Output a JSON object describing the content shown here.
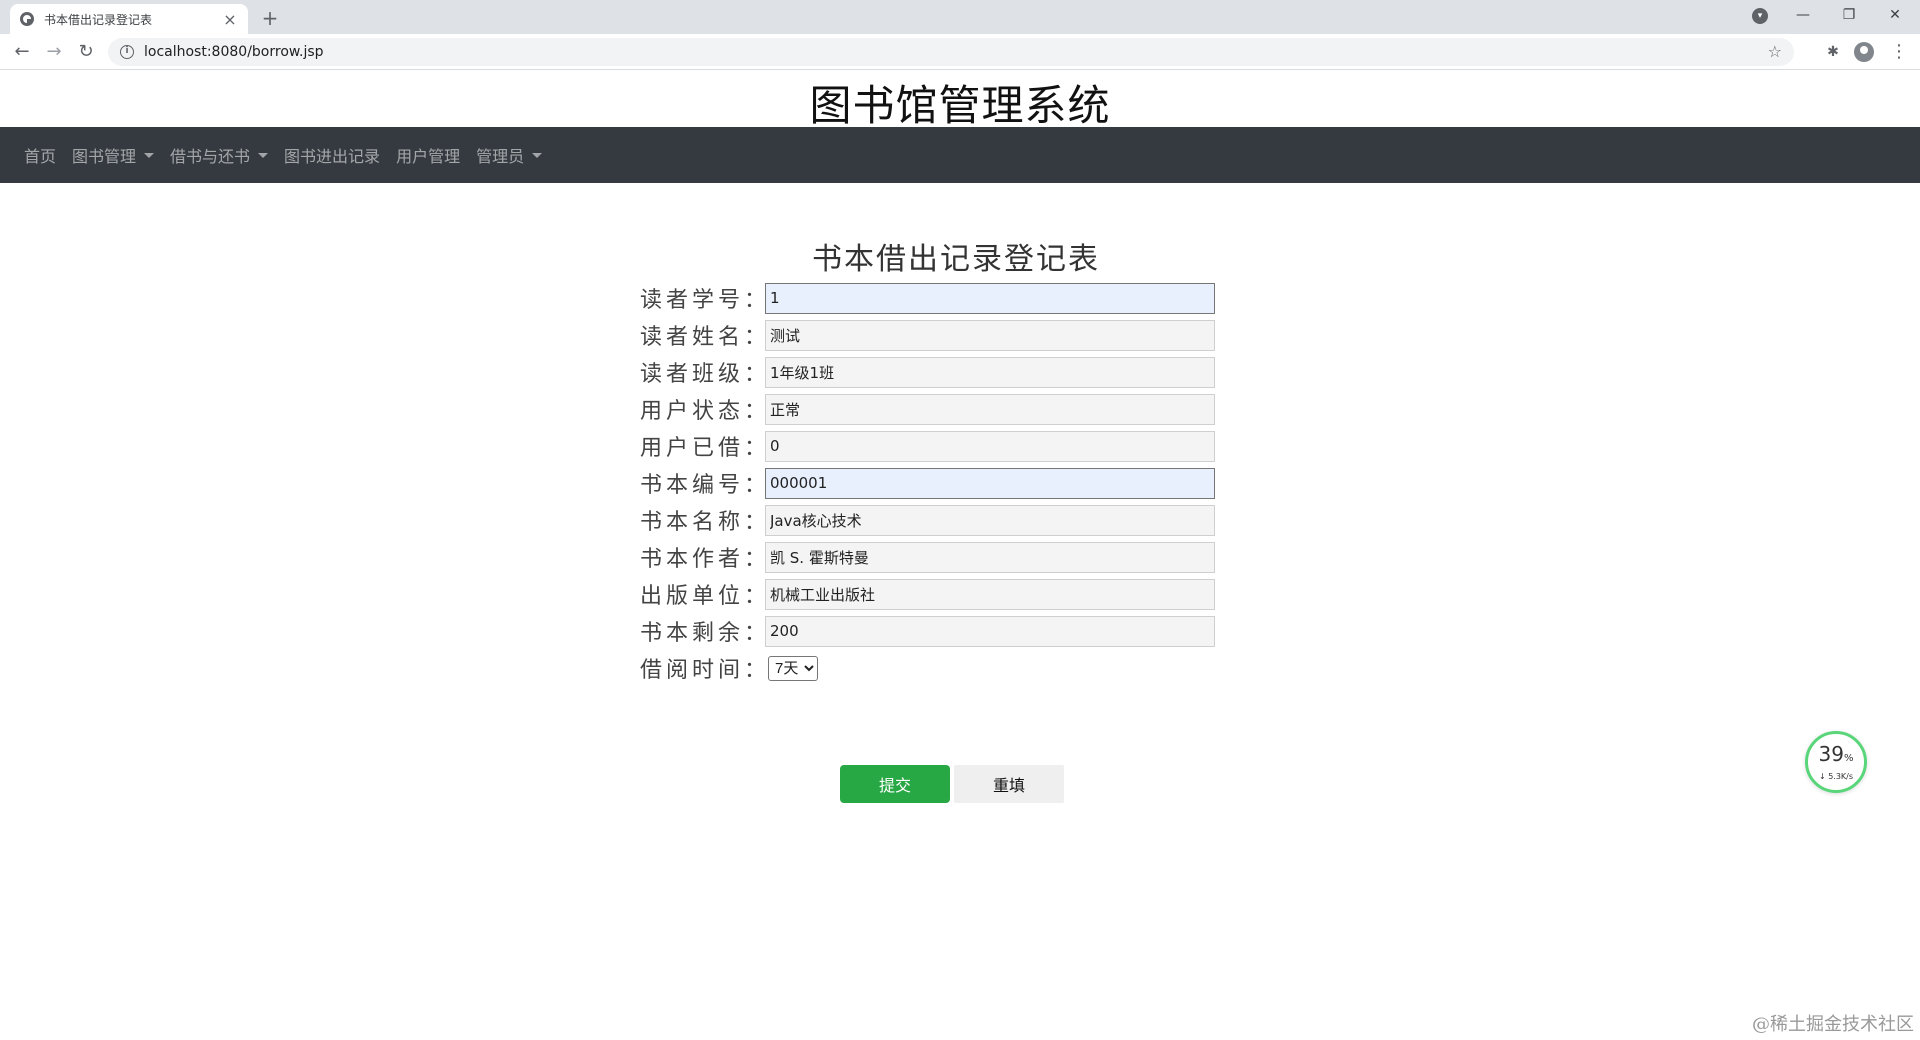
{
  "browser": {
    "tab_title": "书本借出记录登记表",
    "tab_close": "×",
    "new_tab": "+",
    "url": "localhost:8080/borrow.jsp",
    "back": "←",
    "forward": "→",
    "reload": "↻",
    "star": "☆",
    "minimize": "—",
    "restore": "❐",
    "close": "✕",
    "menu": "⋮",
    "extensions": "✱",
    "tab_search": "▾"
  },
  "site": {
    "title": "图书馆管理系统"
  },
  "nav": {
    "items": [
      {
        "label": "首页",
        "dropdown": false
      },
      {
        "label": "图书管理",
        "dropdown": true
      },
      {
        "label": "借书与还书",
        "dropdown": true
      },
      {
        "label": "图书进出记录",
        "dropdown": false
      },
      {
        "label": "用户管理",
        "dropdown": false
      },
      {
        "label": "管理员",
        "dropdown": true
      }
    ]
  },
  "form": {
    "title": "书本借出记录登记表",
    "fields": [
      {
        "label": "读者学号：",
        "value": "1",
        "editable": true
      },
      {
        "label": "读者姓名：",
        "value": "测试",
        "editable": false
      },
      {
        "label": "读者班级：",
        "value": "1年级1班",
        "editable": false
      },
      {
        "label": "用户状态：",
        "value": "正常",
        "editable": false
      },
      {
        "label": "用户已借：",
        "value": "0",
        "editable": false
      },
      {
        "label": "书本编号：",
        "value": "000001",
        "editable": true
      },
      {
        "label": "书本名称：",
        "value": "Java核心技术",
        "editable": false
      },
      {
        "label": "书本作者：",
        "value": "凯 S. 霍斯特曼",
        "editable": false
      },
      {
        "label": "出版单位：",
        "value": "机械工业出版社",
        "editable": false
      },
      {
        "label": "书本剩余：",
        "value": "200",
        "editable": false
      }
    ],
    "duration": {
      "label": "借阅时间：",
      "selected": "7天"
    },
    "submit_label": "提交",
    "reset_label": "重填"
  },
  "overlay": {
    "speed_percent": "39",
    "speed_unit": "%",
    "speed_rate": "↓ 5.3K/s",
    "watermark": "@稀土掘金技术社区"
  },
  "colors": {
    "navbar_bg": "#343a40",
    "submit_bg": "#28a745",
    "editable_field_bg": "#e8f0fe"
  }
}
